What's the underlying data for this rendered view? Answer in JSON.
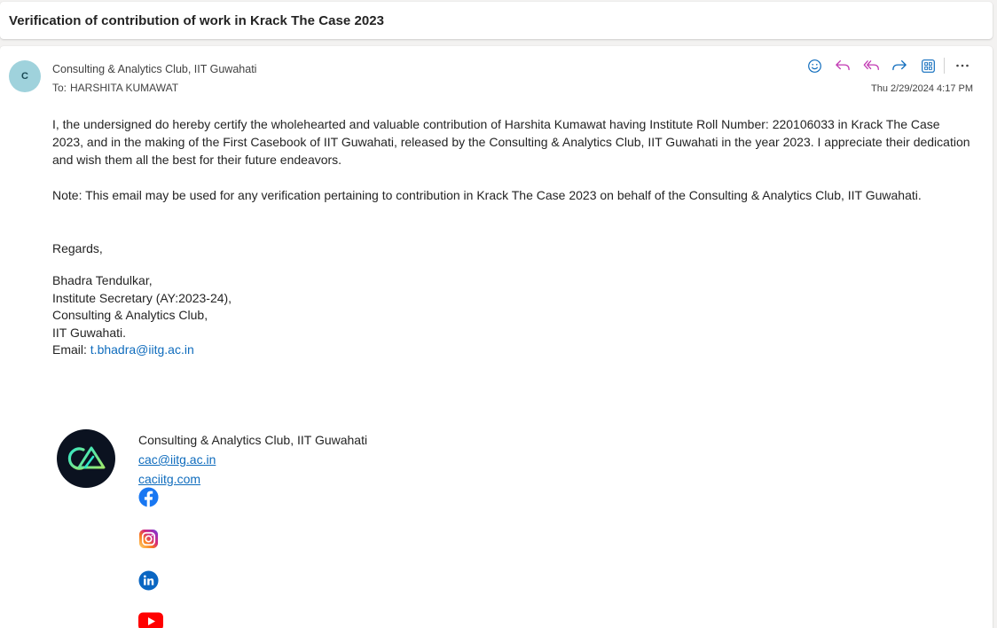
{
  "subject": "Verification of contribution of work in Krack The Case 2023",
  "sender": {
    "initial": "C",
    "name": "Consulting & Analytics Club, IIT Guwahati",
    "to_label": "To:",
    "to_name": "HARSHITA KUMAWAT"
  },
  "timestamp": "Thu 2/29/2024 4:17 PM",
  "actions": [
    "emoji-icon",
    "reply-icon",
    "reply-all-icon",
    "forward-icon",
    "apps-icon",
    "more-icon"
  ],
  "body": {
    "paragraph1": "I, the undersigned do hereby certify the wholehearted and valuable contribution of Harshita Kumawat having Institute Roll Number: 220106033 in Krack The Case 2023, and in the making of the First Casebook of IIT Guwahati, released by the Consulting & Analytics Club, IIT Guwahati in the year 2023. I appreciate their dedication and wish them all the best for their future endeavors.",
    "paragraph2": "Note: This email may be used for any verification pertaining to contribution in Krack The Case 2023 on behalf of the Consulting & Analytics Club, IIT Guwahati.",
    "regards": "Regards,",
    "signature": {
      "name": "Bhadra Tendulkar,",
      "role": "Institute Secretary (AY:2023-24),",
      "club": "Consulting & Analytics Club,",
      "institute": "IIT Guwahati.",
      "email_label": "Email: ",
      "email": "t.bhadra@iitg.ac.in"
    }
  },
  "club_signature": {
    "name": "Consulting & Analytics Club, IIT Guwahati",
    "email": "cac@iitg.ac.in",
    "website": "caciitg.com",
    "socials": [
      "facebook-icon",
      "instagram-icon",
      "linkedin-icon",
      "youtube-icon"
    ]
  },
  "colors": {
    "accent": "#0f6cbd",
    "avatar_bg": "#9fd2dc",
    "reply_icon": "#c239b3"
  }
}
